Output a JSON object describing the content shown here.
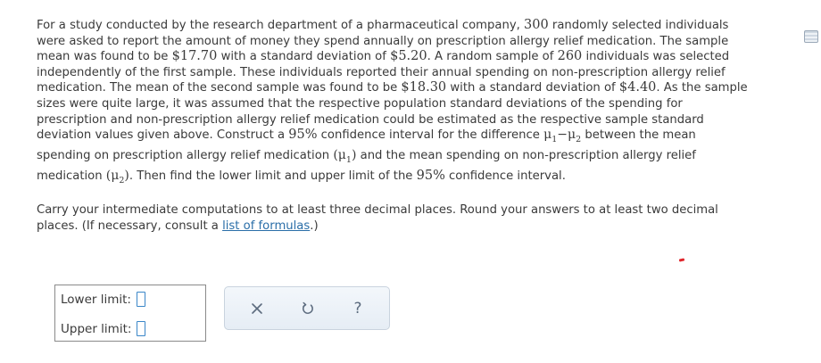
{
  "problem": {
    "line1": "For a study conducted by the research department of a pharmaceutical company, ",
    "n1": "300",
    "line1b": " randomly selected individuals",
    "line2": "were asked to report the amount of money they spend annually on prescription allergy relief medication. The sample",
    "line3a": "mean was found to be ",
    "mean1": "$17.70",
    "line3b": " with a standard deviation of ",
    "sd1": "$5.20",
    "line3c": ". A random sample of ",
    "n2": "260",
    "line3d": " individuals was selected",
    "line4": "independently of the first sample. These individuals reported their annual spending on non-prescription allergy relief",
    "line5a": "medication. The mean of the second sample was found to be ",
    "mean2": "$18.30",
    "line5b": " with a standard deviation of ",
    "sd2": "$4.40",
    "line5c": ". As the sample",
    "line6": "sizes were quite large, it was assumed that the respective population standard deviations of the spending for",
    "line7": "prescription and non-prescription allergy relief medication could be estimated as the respective sample standard",
    "line8a": "deviation values given above. Construct a ",
    "conf1": "95%",
    "line8b": " confidence interval for the difference ",
    "line8c": " between the mean",
    "line9a": "spending on prescription allergy relief medication ",
    "line9b": " and the mean spending on non-prescription allergy relief",
    "line10a": "medication ",
    "line10b": ". Then find the lower limit and upper limit of the ",
    "conf2": "95%",
    "line10c": " confidence interval.",
    "mu_symbol": "μ",
    "minus": "−",
    "sub1": "1",
    "sub2": "2",
    "open_paren": "(",
    "close_paren": ")"
  },
  "instructions": {
    "line1": "Carry your intermediate computations to at least three decimal places. Round your answers to at least two decimal",
    "line2a": "places. (If necessary, consult a ",
    "link": "list of formulas",
    "line2b": ".)"
  },
  "answer": {
    "lower_label": "Lower limit:",
    "upper_label": "Upper limit:",
    "lower_value": "",
    "upper_value": ""
  },
  "toolbar": {
    "clear_icon": "close-icon",
    "undo_icon": "undo-icon",
    "help_label": "?"
  },
  "colors": {
    "text": "#3a3a3a",
    "link": "#2a6ea8",
    "input_border": "#3a86c8",
    "toolbar_bg": "#e6edf5",
    "marker": "#e0262c"
  }
}
